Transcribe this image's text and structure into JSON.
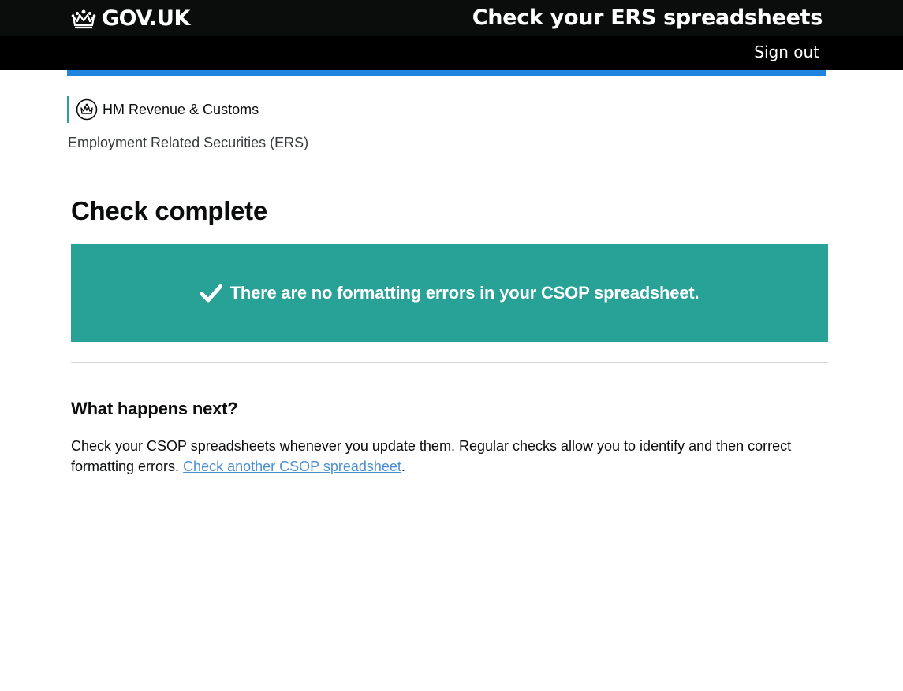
{
  "header": {
    "brand": "GOV.UK",
    "service_name": "Check your ERS spreadsheets",
    "sign_out": "Sign out"
  },
  "organisation": {
    "name": "HM Revenue & Customs",
    "section": "Employment Related Securities (ERS)"
  },
  "main": {
    "title": "Check complete",
    "panel_text": "There are no formatting errors in your CSOP spreadsheet.",
    "next_heading": "What happens next?",
    "next_body": "Check your CSOP spreadsheets whenever you update them. Regular checks allow you to identify and then correct formatting errors.",
    "next_link": "Check another CSOP spreadsheet",
    "next_suffix": "."
  },
  "colors": {
    "header_bg": "#0b0c0c",
    "accent_bar": "#1f84e0",
    "panel_bg": "#28a197",
    "org_stripe": "#28a197",
    "link": "#4c8fd0"
  },
  "icons": {
    "brand": "crown-icon",
    "organisation": "hmrc-crest-icon",
    "panel": "checkmark-icon"
  }
}
